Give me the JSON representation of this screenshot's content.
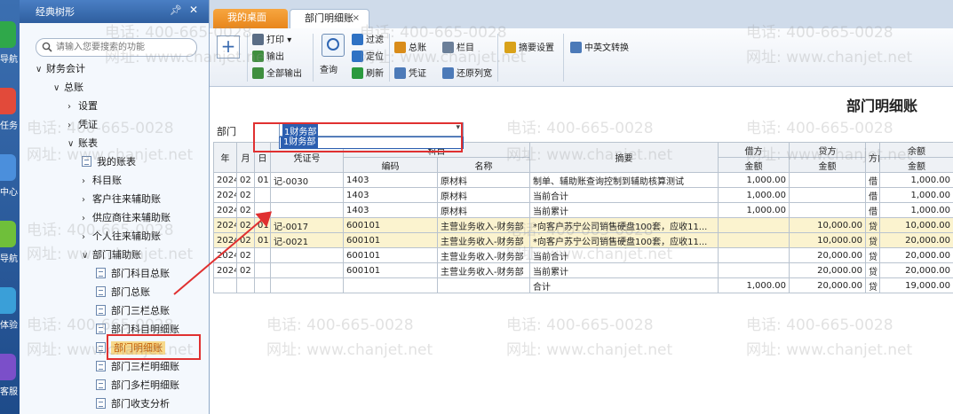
{
  "sidebar_strip": {
    "items": [
      {
        "label": "导航",
        "color": "#2fa84a"
      },
      {
        "label": "任务",
        "color": "#e24a3a"
      },
      {
        "label": "中心",
        "color": "#4b8fdc"
      },
      {
        "label": "导航",
        "color": "#6fbf3a"
      },
      {
        "label": "体验",
        "color": "#3a9fd8"
      },
      {
        "label": "客服",
        "color": "#7b4fc9"
      }
    ]
  },
  "tree": {
    "title": "经典树形",
    "pin_icon": "pin-icon",
    "search_placeholder": "请输入您要搜索的功能",
    "nodes": [
      {
        "label": "财务会计"
      },
      {
        "label": "总账"
      },
      {
        "label": "设置"
      },
      {
        "label": "凭证"
      },
      {
        "label": "账表"
      },
      {
        "label": "我的账表"
      },
      {
        "label": "科目账"
      },
      {
        "label": "客户往来辅助账"
      },
      {
        "label": "供应商往来辅助账"
      },
      {
        "label": "个人往来辅助账"
      },
      {
        "label": "部门辅助账"
      },
      {
        "label": "部门科目总账"
      },
      {
        "label": "部门总账"
      },
      {
        "label": "部门三栏总账"
      },
      {
        "label": "部门科目明细账"
      },
      {
        "label": "部门明细账"
      },
      {
        "label": "部门三栏明细账"
      },
      {
        "label": "部门多栏明细账"
      },
      {
        "label": "部门收支分析"
      }
    ]
  },
  "tabs": {
    "desk": "我的桌面",
    "dept": "部门明细账",
    "close": "×"
  },
  "toolbar": {
    "print": "打印",
    "export": "输出",
    "export_all": "全部输出",
    "query": "查询",
    "filter": "过滤",
    "locate": "定位",
    "refresh": "刷新",
    "ledger": "总账",
    "voucher": "凭证",
    "columns": "栏目",
    "restore_width": "还原列宽",
    "summary_setting": "摘要设置",
    "cn_en": "中英文转换",
    "colors": {
      "print": "#5a6d86",
      "export": "#3f8f3f",
      "export_all": "#3f8f3f",
      "filter": "#2f72c4",
      "locate": "#2f72c4",
      "refresh": "#2b9a3e",
      "ledger": "#d98c1a",
      "voucher": "#4c7ab8",
      "columns": "#6b7f99",
      "restore_width": "#4c7ab8",
      "summary_setting": "#d9a21a",
      "cn_en": "#4c7ab8"
    }
  },
  "report": {
    "title": "部门明细账",
    "dept_label": "部门",
    "dept_value": "1财务部",
    "dept_option": "1财务部",
    "headers": {
      "year": "年",
      "month": "月",
      "day": "日",
      "voucher_no": "凭证号",
      "subject": "科目",
      "code": "编码",
      "name": "名称",
      "summary": "摘要",
      "debit": "借方",
      "credit": "贷方",
      "direction": "方向",
      "balance": "余额",
      "amount": "金额"
    },
    "rows": [
      {
        "y": "2024",
        "m": "02",
        "d": "01",
        "v": "记-0030",
        "code": "1403",
        "name": "原材料",
        "summary": "制单、辅助账查询控制到辅助核算测试",
        "debit": "1,000.00",
        "credit": "",
        "dir": "借",
        "bal": "1,000.00",
        "hl": false
      },
      {
        "y": "2024",
        "m": "02",
        "d": "",
        "v": "",
        "code": "1403",
        "name": "原材料",
        "summary": "当前合计",
        "debit": "1,000.00",
        "credit": "",
        "dir": "借",
        "bal": "1,000.00",
        "hl": false
      },
      {
        "y": "2024",
        "m": "02",
        "d": "",
        "v": "",
        "code": "1403",
        "name": "原材料",
        "summary": "当前累计",
        "debit": "1,000.00",
        "credit": "",
        "dir": "借",
        "bal": "1,000.00",
        "hl": false
      },
      {
        "y": "2024",
        "m": "02",
        "d": "01",
        "v": "记-0017",
        "code": "600101",
        "name": "主营业务收入-财务部",
        "summary": "*向客户苏宁公司销售硬盘100套，应收11...",
        "debit": "",
        "credit": "10,000.00",
        "dir": "贷",
        "bal": "10,000.00",
        "hl": true
      },
      {
        "y": "2024",
        "m": "02",
        "d": "01",
        "v": "记-0021",
        "code": "600101",
        "name": "主营业务收入-财务部",
        "summary": "*向客户苏宁公司销售硬盘100套，应收11...",
        "debit": "",
        "credit": "10,000.00",
        "dir": "贷",
        "bal": "20,000.00",
        "hl": true
      },
      {
        "y": "2024",
        "m": "02",
        "d": "",
        "v": "",
        "code": "600101",
        "name": "主营业务收入-财务部",
        "summary": "当前合计",
        "debit": "",
        "credit": "20,000.00",
        "dir": "贷",
        "bal": "20,000.00",
        "hl": false
      },
      {
        "y": "2024",
        "m": "02",
        "d": "",
        "v": "",
        "code": "600101",
        "name": "主营业务收入-财务部",
        "summary": "当前累计",
        "debit": "",
        "credit": "20,000.00",
        "dir": "贷",
        "bal": "20,000.00",
        "hl": false
      },
      {
        "y": "",
        "m": "",
        "d": "",
        "v": "",
        "code": "",
        "name": "",
        "summary": "合计",
        "debit": "1,000.00",
        "credit": "20,000.00",
        "dir": "贷",
        "bal": "19,000.00",
        "hl": false
      }
    ]
  },
  "watermark": {
    "phone": "电话: 400-665-0028",
    "site": "网址: www.chanjet.net"
  },
  "colors": {
    "annotation_red": "#e03030",
    "highlight_row": "#fbf3cf",
    "selected_node": "#f7d98b"
  }
}
